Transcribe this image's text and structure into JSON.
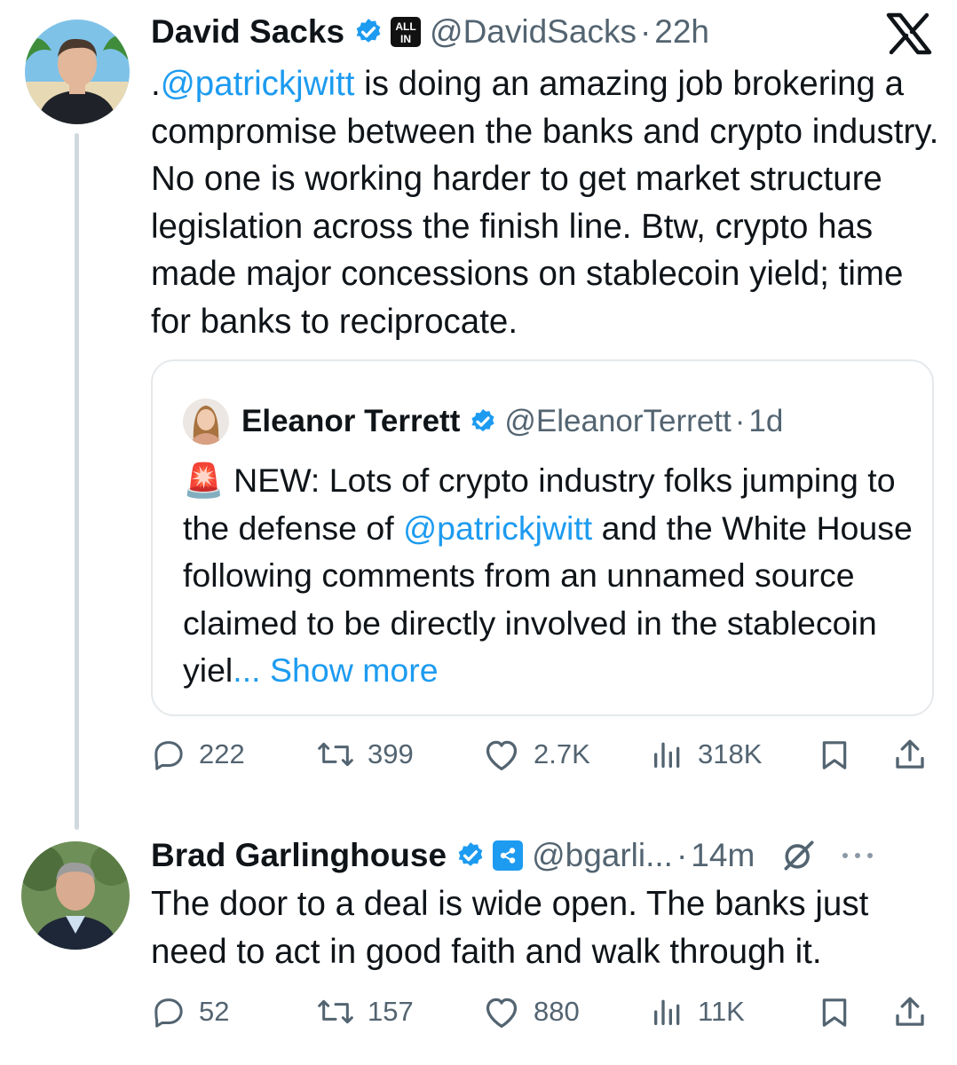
{
  "tweets": [
    {
      "author": {
        "name": "David Sacks",
        "handle": "@DavidSacks",
        "time": "22h",
        "badge_text": "ALL IN"
      },
      "text": {
        "prefix": ".",
        "mention": "@patrickjwitt",
        "rest": " is doing an amazing job brokering a compromise between the banks and crypto industry. No one is working harder to get market structure legislation across the finish line. Btw, crypto has made major concessions on stablecoin yield; time for banks to reciprocate."
      },
      "quote": {
        "author": {
          "name": "Eleanor Terrett",
          "handle": "@EleanorTerrett",
          "time": "1d"
        },
        "emoji": "🚨",
        "text_before": " NEW: Lots of crypto industry folks jumping to the defense of ",
        "mention": "@patrickjwitt",
        "text_after": " and the White House following comments from an unnamed source claimed to be directly involved in the stablecoin yiel",
        "truncated_ellipsis": "...",
        "show_more_label": "Show more"
      },
      "stats": {
        "replies": "222",
        "reposts": "399",
        "likes": "2.7K",
        "views": "318K"
      }
    },
    {
      "author": {
        "name": "Brad Garlinghouse",
        "handle": "@bgarli...",
        "time": "14m"
      },
      "text": "The door to a deal is wide open. The banks just need to act in good faith and walk through it.",
      "stats": {
        "replies": "52",
        "reposts": "157",
        "likes": "880",
        "views": "11K"
      }
    }
  ],
  "icons": {
    "platform": "x-logo",
    "verified": "verified-check-icon",
    "reply": "comment-icon",
    "repost": "repost-icon",
    "like": "heart-icon",
    "views": "views-bar-chart-icon",
    "bookmark": "bookmark-icon",
    "share": "share-icon",
    "grok": "grok-icon",
    "more": "more-icon"
  },
  "colors": {
    "text": "#0f1419",
    "muted": "#536471",
    "link": "#1d9bf0",
    "verified": "#1d9bf0",
    "border": "#e5e9ec"
  }
}
